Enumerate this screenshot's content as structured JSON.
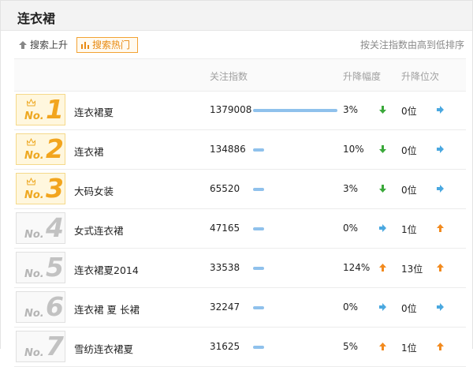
{
  "header": {
    "title": "连衣裙"
  },
  "tabs": [
    {
      "label": "搜索上升",
      "icon": "arrow-up-icon",
      "active": false
    },
    {
      "label": "搜索热门",
      "icon": "bar-chart-icon",
      "active": true
    }
  ],
  "sort_note": "按关注指数由高到低排序",
  "columns": {
    "index": "关注指数",
    "change": "升降幅度",
    "rank_change": "升降位次"
  },
  "colors": {
    "accent": "#f2a51e",
    "bar": "#8fc1ec",
    "down": "#3aa83a",
    "up": "#f28a1e",
    "flat": "#4aa8e0"
  },
  "rows": [
    {
      "no": "No.",
      "rank": "1",
      "keyword": "连衣裙夏",
      "index": "1379008",
      "index_value": 1379008,
      "change": "3%",
      "change_dir": "down",
      "rank_change": "0位",
      "rank_dir": "flat"
    },
    {
      "no": "No.",
      "rank": "2",
      "keyword": "连衣裙",
      "index": "134886",
      "index_value": 134886,
      "change": "10%",
      "change_dir": "down",
      "rank_change": "0位",
      "rank_dir": "flat"
    },
    {
      "no": "No.",
      "rank": "3",
      "keyword": "大码女装",
      "index": "65520",
      "index_value": 65520,
      "change": "3%",
      "change_dir": "down",
      "rank_change": "0位",
      "rank_dir": "flat"
    },
    {
      "no": "No.",
      "rank": "4",
      "keyword": "女式连衣裙",
      "index": "47165",
      "index_value": 47165,
      "change": "0%",
      "change_dir": "flat",
      "rank_change": "1位",
      "rank_dir": "up"
    },
    {
      "no": "No.",
      "rank": "5",
      "keyword": "连衣裙夏2014",
      "index": "33538",
      "index_value": 33538,
      "change": "124%",
      "change_dir": "up",
      "rank_change": "13位",
      "rank_dir": "up"
    },
    {
      "no": "No.",
      "rank": "6",
      "keyword": "连衣裙 夏 长裙",
      "index": "32247",
      "index_value": 32247,
      "change": "0%",
      "change_dir": "flat",
      "rank_change": "0位",
      "rank_dir": "flat"
    },
    {
      "no": "No.",
      "rank": "7",
      "keyword": "雪纺连衣裙夏",
      "index": "31625",
      "index_value": 31625,
      "change": "5%",
      "change_dir": "up",
      "rank_change": "1位",
      "rank_dir": "up"
    }
  ]
}
